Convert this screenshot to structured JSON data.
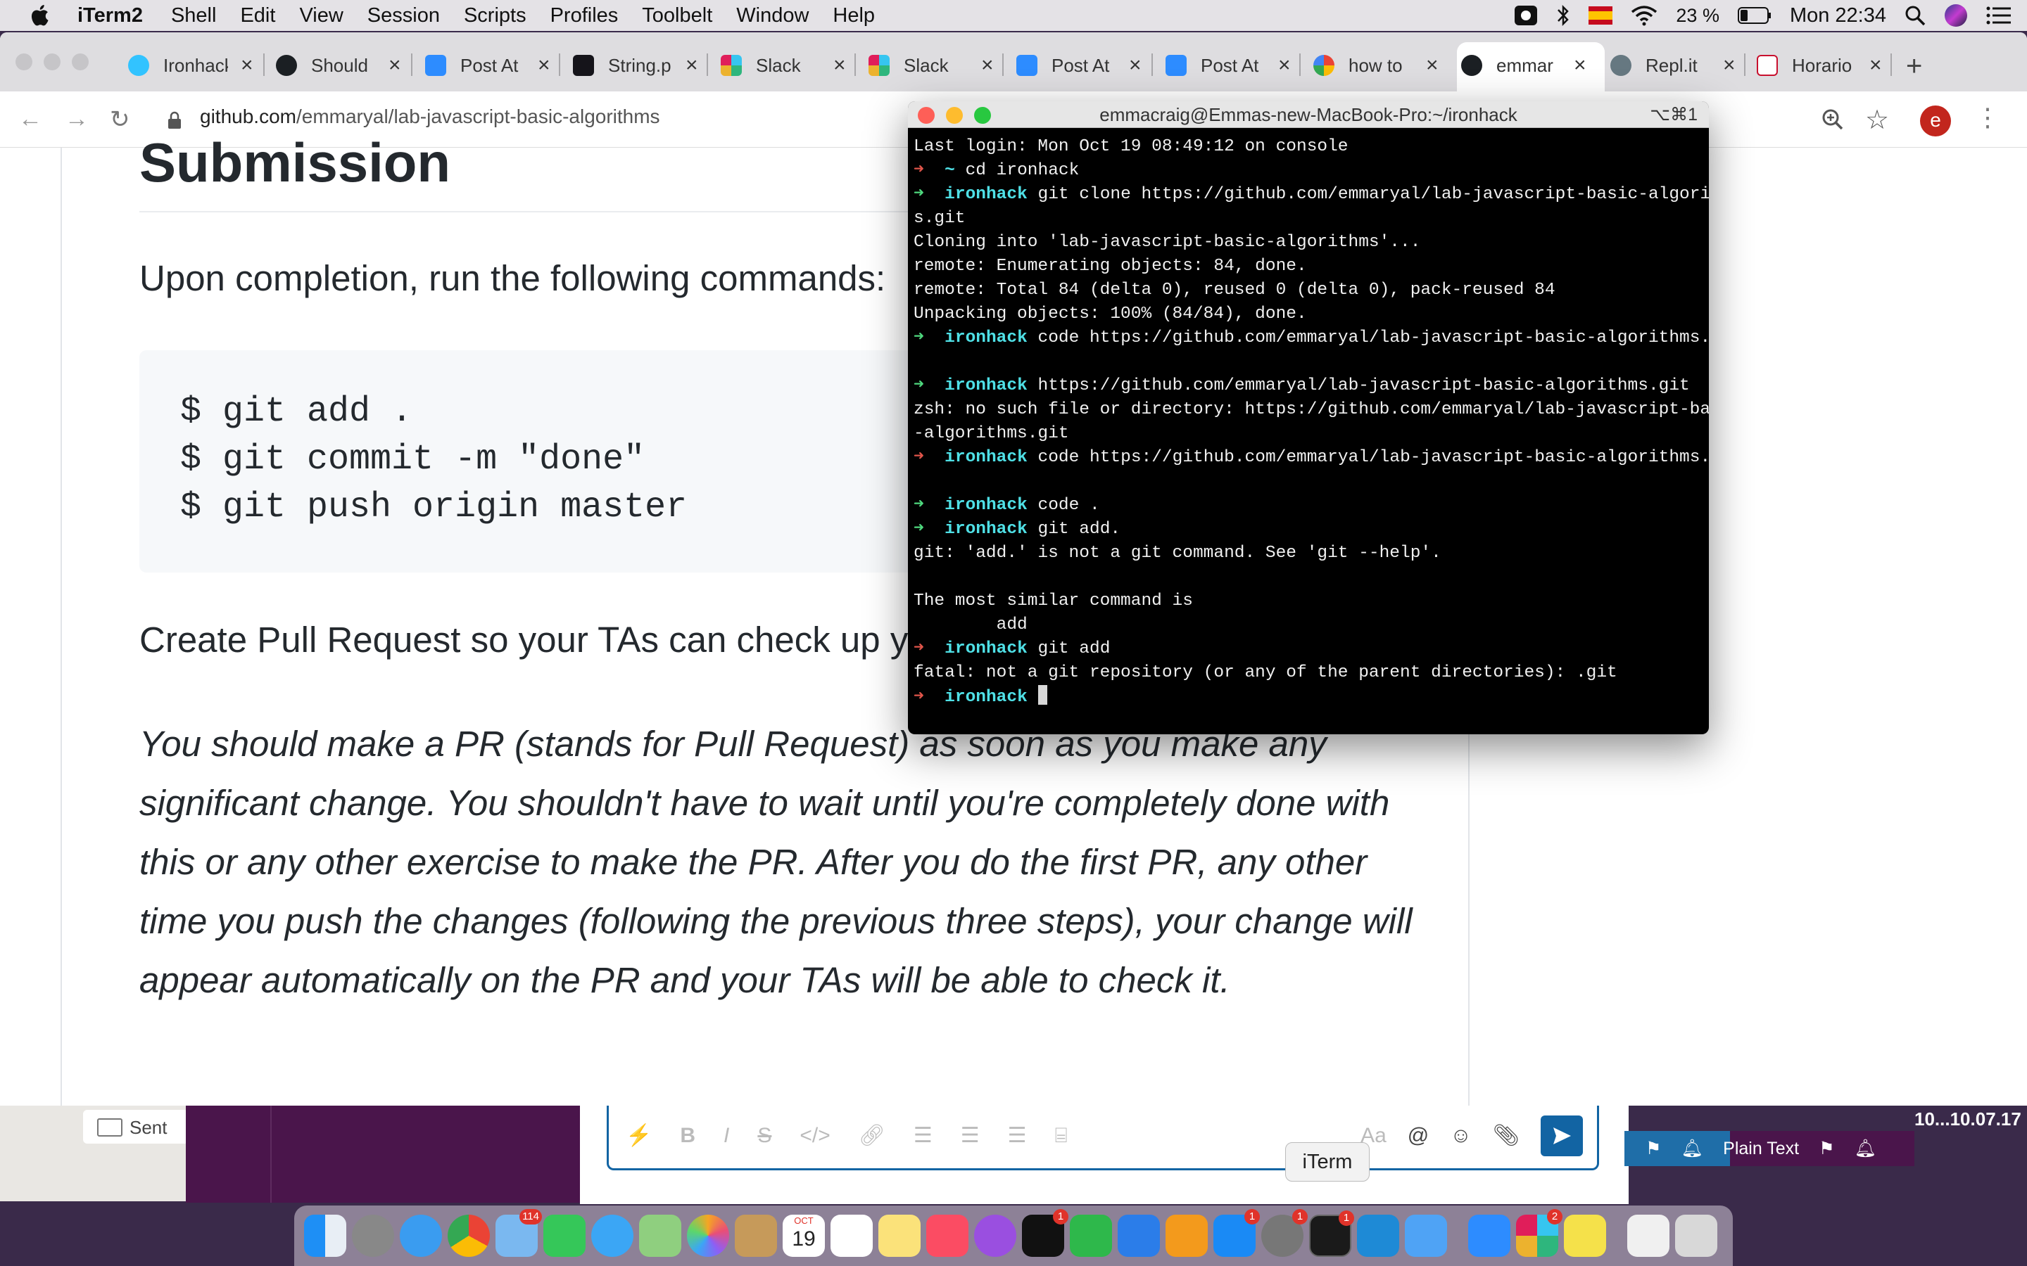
{
  "menubar": {
    "app_name": "iTerm2",
    "items": [
      "Shell",
      "Edit",
      "View",
      "Session",
      "Scripts",
      "Profiles",
      "Toolbelt",
      "Window",
      "Help"
    ],
    "battery": "23 %",
    "clock": "Mon 22:34"
  },
  "browser": {
    "tabs": [
      {
        "label": "Ironhack",
        "icon": "ironhack-icon"
      },
      {
        "label": "Should",
        "icon": "github-icon"
      },
      {
        "label": "Post At",
        "icon": "zoom-icon"
      },
      {
        "label": "String.p",
        "icon": "mdn-icon"
      },
      {
        "label": "Slack",
        "icon": "slack-icon"
      },
      {
        "label": "Slack",
        "icon": "slack-icon"
      },
      {
        "label": "Post At",
        "icon": "zoom-icon"
      },
      {
        "label": "Post At",
        "icon": "zoom-icon"
      },
      {
        "label": "how to",
        "icon": "google-icon"
      },
      {
        "label": "emmar",
        "icon": "github-icon"
      },
      {
        "label": "Repl.it",
        "icon": "replit-icon"
      },
      {
        "label": "Horario",
        "icon": "gencat-icon"
      }
    ],
    "url_host": "github.com",
    "url_path": "/emmaryal/lab-javascript-basic-algorithms",
    "profile_initial": "e"
  },
  "article": {
    "heading": "Submission",
    "para1": "Upon completion, run the following commands:",
    "code_lines": [
      "$ git add .",
      "$ git commit -m \"done\"",
      "$ git push origin master"
    ],
    "para2": "Create Pull Request so your TAs can check up your work.",
    "para3": "You should make a PR (stands for Pull Request) as soon as you make any significant change. You shouldn't have to wait until you're completely done with this or any other exercise to make the PR. After you do the first PR, any other time you push the changes (following the previous three steps), your change will appear automatically on the PR and your TAs will be able to check it."
  },
  "terminal": {
    "title": "emmacraig@Emmas-new-MacBook-Pro:~/ironhack",
    "shortcut": "⌥⌘1",
    "lines": [
      {
        "type": "plain",
        "text": "Last login: Mon Oct 19 08:49:12 on console"
      },
      {
        "type": "prompt",
        "arrow": "err",
        "cwd": "~",
        "cmd": "cd ironhack"
      },
      {
        "type": "prompt",
        "arrow": "ok",
        "cwd": "ironhack",
        "cmd": "git clone https://github.com/emmaryal/lab-javascript-basic-algorithm"
      },
      {
        "type": "plain",
        "text": "s.git"
      },
      {
        "type": "plain",
        "text": "Cloning into 'lab-javascript-basic-algorithms'..."
      },
      {
        "type": "plain",
        "text": "remote: Enumerating objects: 84, done."
      },
      {
        "type": "plain",
        "text": "remote: Total 84 (delta 0), reused 0 (delta 0), pack-reused 84"
      },
      {
        "type": "plain",
        "text": "Unpacking objects: 100% (84/84), done."
      },
      {
        "type": "prompt",
        "arrow": "ok",
        "cwd": "ironhack",
        "cmd": "code https://github.com/emmaryal/lab-javascript-basic-algorithms.git"
      },
      {
        "type": "plain",
        "text": ""
      },
      {
        "type": "prompt",
        "arrow": "ok",
        "cwd": "ironhack",
        "cmd": "https://github.com/emmaryal/lab-javascript-basic-algorithms.git"
      },
      {
        "type": "plain",
        "text": "zsh: no such file or directory: https://github.com/emmaryal/lab-javascript-basic"
      },
      {
        "type": "plain",
        "text": "-algorithms.git"
      },
      {
        "type": "prompt",
        "arrow": "err",
        "cwd": "ironhack",
        "cmd": "code https://github.com/emmaryal/lab-javascript-basic-algorithms.git"
      },
      {
        "type": "plain",
        "text": ""
      },
      {
        "type": "prompt",
        "arrow": "ok",
        "cwd": "ironhack",
        "cmd": "code ."
      },
      {
        "type": "prompt",
        "arrow": "ok",
        "cwd": "ironhack",
        "cmd": "git add."
      },
      {
        "type": "plain",
        "text": "git: 'add.' is not a git command. See 'git --help'."
      },
      {
        "type": "plain",
        "text": ""
      },
      {
        "type": "plain",
        "text": "The most similar command is"
      },
      {
        "type": "plain",
        "text": "        add"
      },
      {
        "type": "prompt",
        "arrow": "err",
        "cwd": "ironhack",
        "cmd": "git add"
      },
      {
        "type": "plain",
        "text": "fatal: not a git repository (or any of the parent directories): .git"
      },
      {
        "type": "prompt",
        "arrow": "err",
        "cwd": "ironhack",
        "cmd": "",
        "cursor": true
      }
    ]
  },
  "background": {
    "mail_sidebar_item": "Sent",
    "plain_text_label": "Plain Text",
    "right_note": "10...10.07.17"
  },
  "dock": {
    "tooltip": "iTerm",
    "calendar_day": "19",
    "calendar_month": "OCT",
    "badges": {
      "mail": "114",
      "appletv": "1",
      "appstore": "1",
      "sysprefs": "1",
      "iterm": "1",
      "slack": "2"
    }
  },
  "colors": {
    "terminal_green": "#4fd87e",
    "terminal_red": "#e0554a",
    "terminal_cyan": "#4fe0e6",
    "slack_purple": "#4a154b"
  }
}
